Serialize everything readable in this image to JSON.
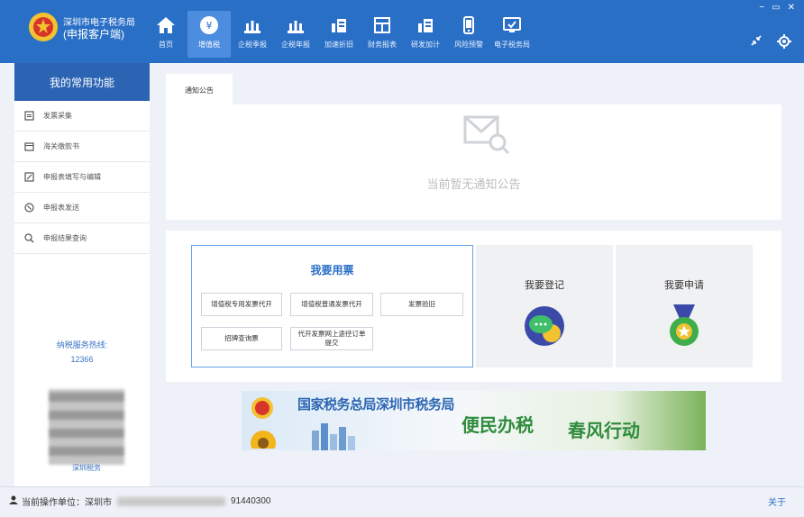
{
  "header": {
    "brand_line1": "深圳市电子税务局",
    "brand_line2": "(申报客户端)",
    "nav": [
      {
        "label": "首页",
        "icon": "home-icon"
      },
      {
        "label": "增值税",
        "icon": "yuan-icon",
        "active": true
      },
      {
        "label": "企税季报",
        "icon": "bank-icon"
      },
      {
        "label": "企税年报",
        "icon": "bank-icon"
      },
      {
        "label": "加速折旧",
        "icon": "chart-icon"
      },
      {
        "label": "财务报表",
        "icon": "report-icon"
      },
      {
        "label": "研发加计",
        "icon": "chart-icon"
      },
      {
        "label": "风险预警",
        "icon": "phone-icon"
      },
      {
        "label": "电子税务局",
        "icon": "monitor-icon"
      }
    ],
    "window_controls": [
      "−",
      "▭",
      "✕"
    ],
    "accent": "#2a6fc6"
  },
  "sidebar": {
    "title": "我的常用功能",
    "items": [
      {
        "label": "发票采集",
        "icon": "invoice-icon"
      },
      {
        "label": "海关缴款书",
        "icon": "wallet-icon"
      },
      {
        "label": "申报表填写与编辑",
        "icon": "edit-icon"
      },
      {
        "label": "申报表发送",
        "icon": "send-icon"
      },
      {
        "label": "申报结果查询",
        "icon": "search-icon"
      }
    ],
    "hotline_label": "纳税服务热线:",
    "hotline_number": "12366",
    "qr_caption": "深圳税务"
  },
  "main": {
    "tab": "通知公告",
    "empty_notice": "当前暂无通知公告",
    "card_main_title": "我要用票",
    "buttons": [
      "增值税专用发票代开",
      "增值税普通发票代开",
      "发票验旧",
      "招牌查询票",
      "代开发票网上途径订单提交"
    ],
    "card_register": "我要登记",
    "card_apply": "我要申请",
    "banner_text1": "国家税务总局深圳市税务局",
    "banner_text2": "便民办税",
    "banner_text3": "春风行动"
  },
  "status": {
    "prefix": "当前操作单位：深圳市",
    "suffix": "91440300",
    "link": "关于"
  }
}
